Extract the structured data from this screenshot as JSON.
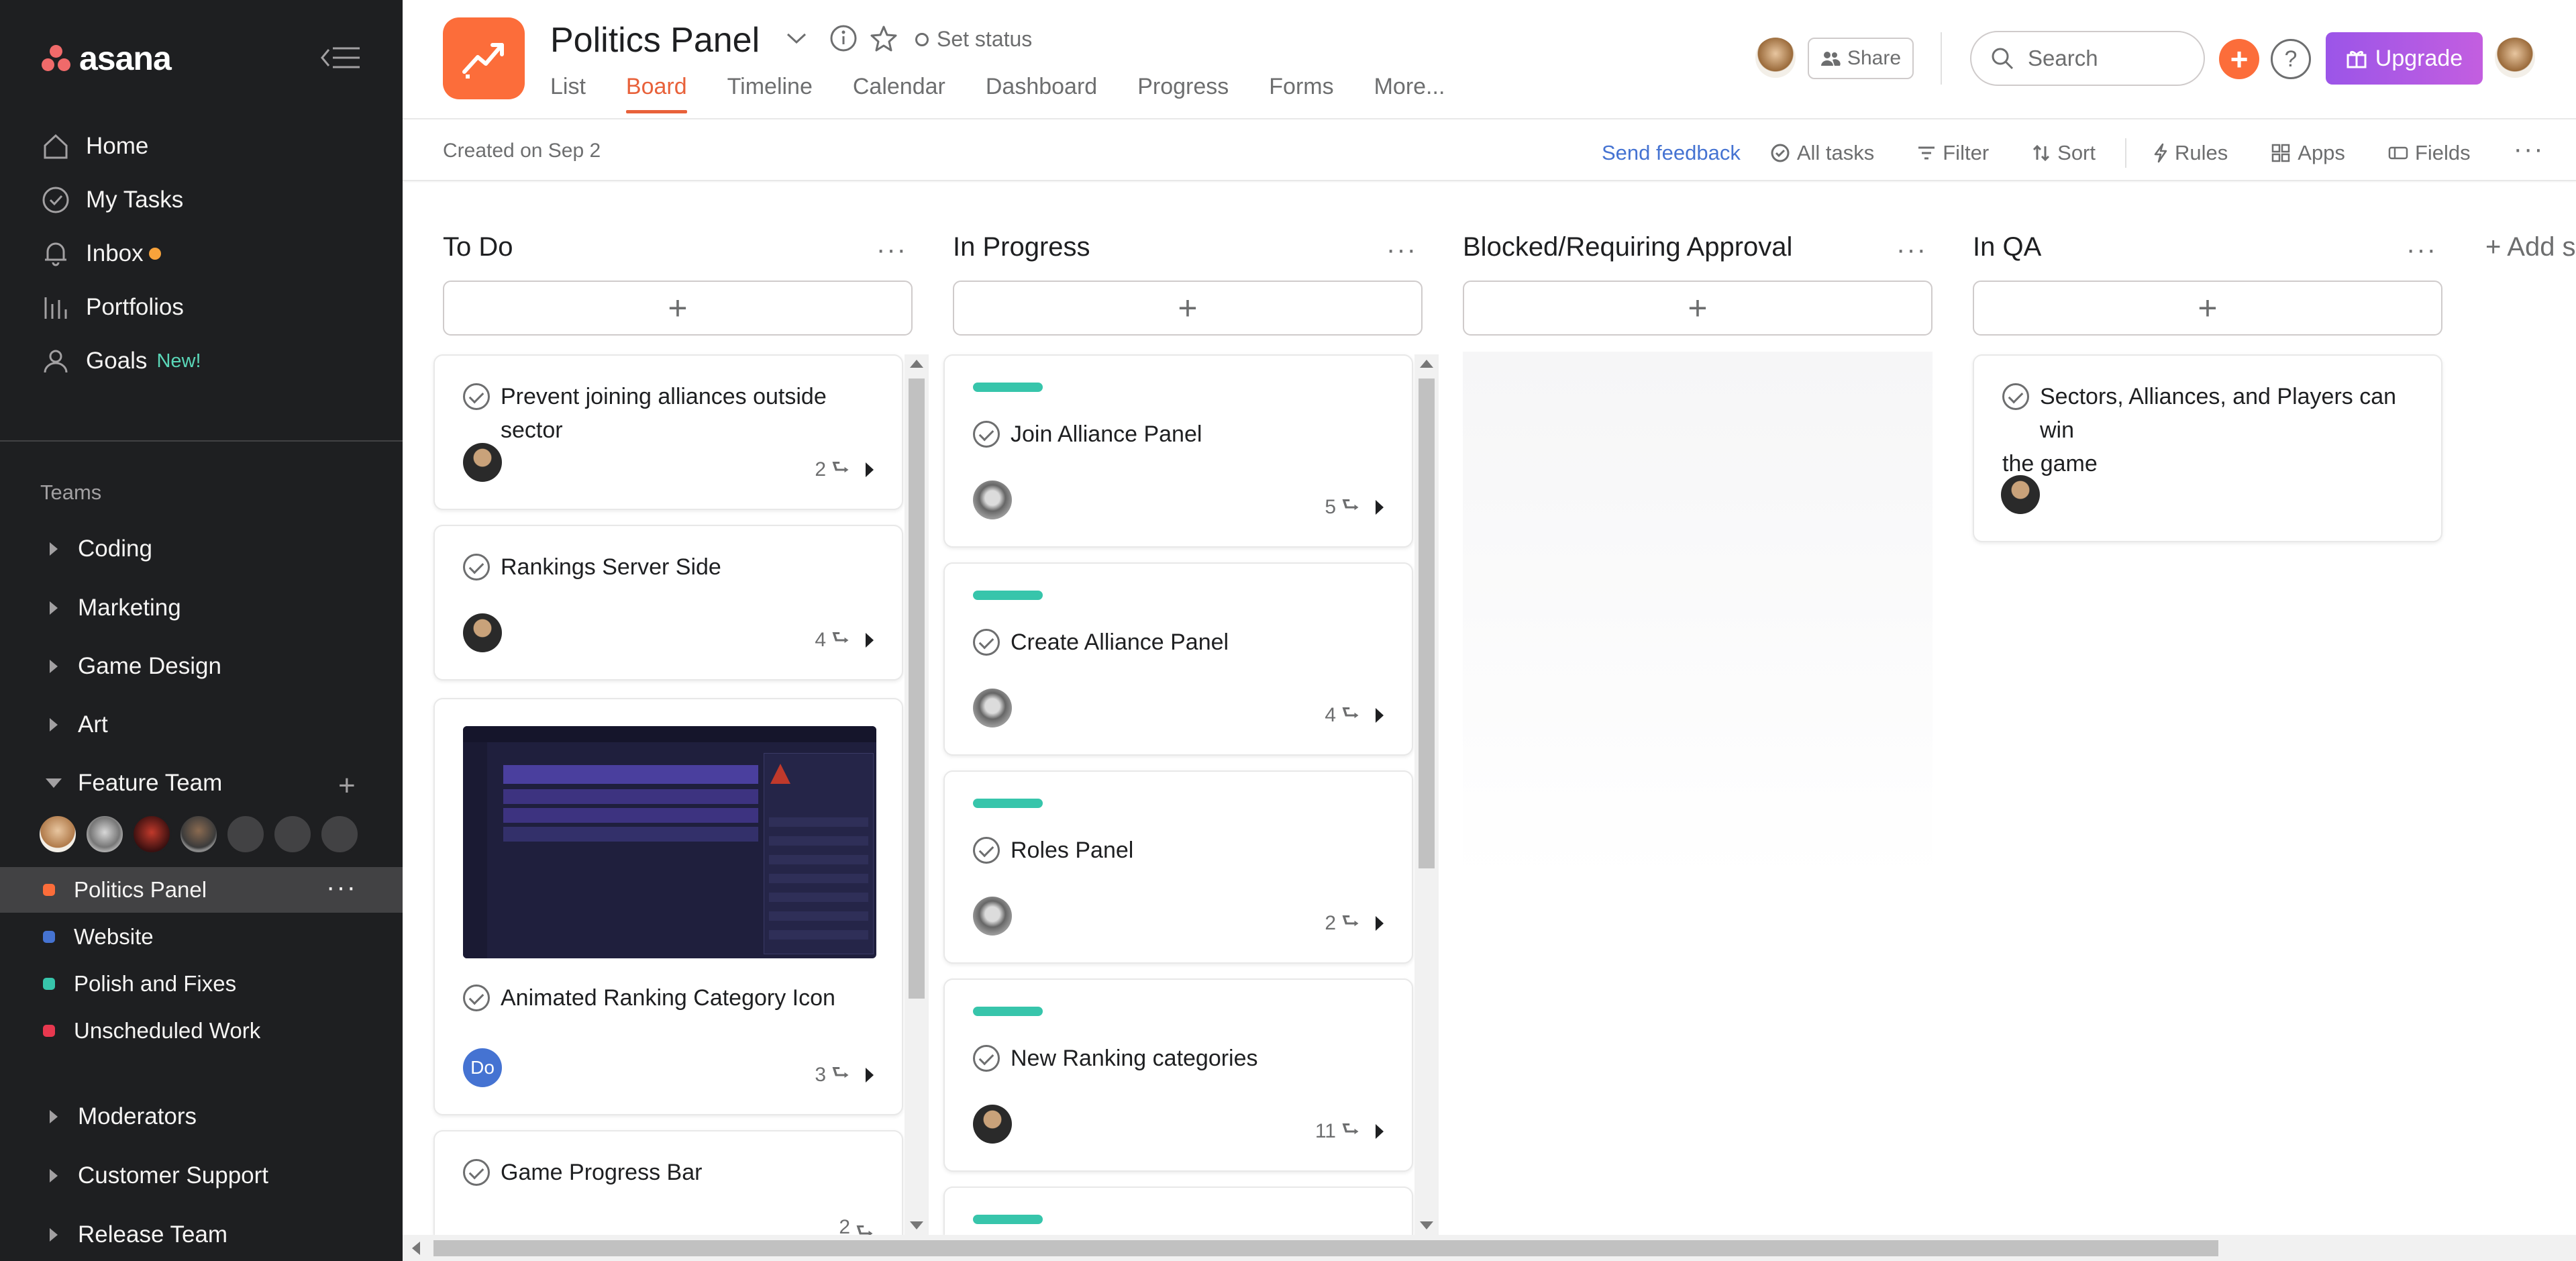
{
  "sidebar": {
    "logo_text": "asana",
    "nav": [
      {
        "label": "Home",
        "icon": "home-icon"
      },
      {
        "label": "My Tasks",
        "icon": "check-circle-icon"
      },
      {
        "label": "Inbox",
        "icon": "bell-icon"
      },
      {
        "label": "Portfolios",
        "icon": "bar-chart-icon"
      },
      {
        "label": "Goals",
        "icon": "person-icon",
        "badge": "New!"
      }
    ],
    "teams_title": "Teams",
    "teams": [
      "Coding",
      "Marketing",
      "Game Design",
      "Art"
    ],
    "feature_team": "Feature Team",
    "projects": [
      {
        "label": "Politics Panel",
        "color": "#fc6d3a"
      },
      {
        "label": "Website",
        "color": "#4573d2"
      },
      {
        "label": "Polish and Fixes",
        "color": "#37c5ab"
      },
      {
        "label": "Unscheduled Work",
        "color": "#e8384f"
      }
    ],
    "teams_bottom": [
      "Moderators",
      "Customer Support",
      "Release Team"
    ]
  },
  "header": {
    "title": "Politics Panel",
    "set_status": "Set status",
    "tabs": [
      "List",
      "Board",
      "Timeline",
      "Calendar",
      "Dashboard",
      "Progress",
      "Forms",
      "More..."
    ],
    "active_tab": "Board",
    "share": "Share",
    "search_placeholder": "Search",
    "upgrade": "Upgrade",
    "accent": "#fc6d3a"
  },
  "subheader": {
    "created": "Created on Sep 2",
    "feedback": "Send feedback",
    "all_tasks": "All tasks",
    "filter": "Filter",
    "sort": "Sort",
    "rules": "Rules",
    "apps": "Apps",
    "fields": "Fields"
  },
  "board": {
    "columns": [
      {
        "title": "To Do",
        "cards": [
          {
            "title": "Prevent joining alliances outside sector",
            "subtasks": "2"
          },
          {
            "title": "Rankings Server Side",
            "subtasks": "4"
          },
          {
            "title": "Animated Ranking Category Icon",
            "subtasks": "3",
            "assignee_initials": "Do"
          },
          {
            "title": "Game Progress Bar",
            "subtasks": "2"
          }
        ]
      },
      {
        "title": "In Progress",
        "cards": [
          {
            "title": "Join Alliance Panel",
            "subtasks": "5"
          },
          {
            "title": "Create Alliance Panel",
            "subtasks": "4"
          },
          {
            "title": "Roles Panel",
            "subtasks": "2"
          },
          {
            "title": "New Ranking categories",
            "subtasks": "11"
          }
        ]
      },
      {
        "title": "Blocked/Requiring Approval",
        "cards": []
      },
      {
        "title": "In QA",
        "cards": [
          {
            "title_lines": [
              "Sectors, Alliances, and Players can win",
              "the game"
            ]
          }
        ]
      }
    ],
    "add_section": "+ Add s"
  }
}
